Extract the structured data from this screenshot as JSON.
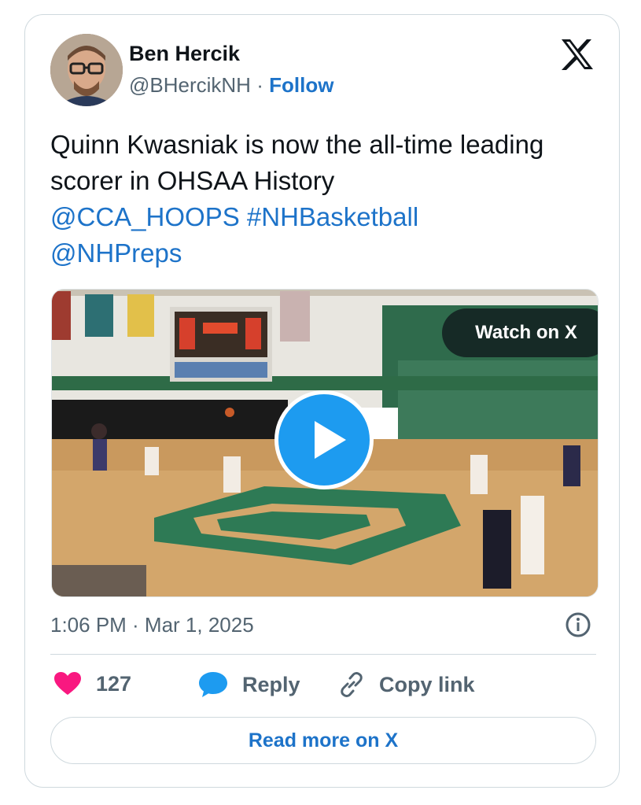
{
  "author": {
    "name": "Ben Hercik",
    "handle": "@BHercikNH",
    "separator": "·",
    "follow_label": "Follow"
  },
  "tweet": {
    "text": "Quinn Kwasniak is now the all-time leading scorer in OHSAA History",
    "links": [
      "@CCA_HOOPS",
      "#NHBasketball",
      "@NHPreps"
    ]
  },
  "media": {
    "watch_label": "Watch on X"
  },
  "meta": {
    "timestamp": "1:06 PM · Mar 1, 2025"
  },
  "actions": {
    "like_count": "127",
    "reply_label": "Reply",
    "copy_link_label": "Copy link"
  },
  "read_more_label": "Read more on X",
  "colors": {
    "link": "#1d73c9",
    "like": "#f91880",
    "reply_icon": "#1d9bf0",
    "play": "#1d9bf0"
  },
  "icons": [
    "x-logo-icon",
    "play-icon",
    "info-icon",
    "heart-icon",
    "reply-bubble-icon",
    "link-icon"
  ]
}
